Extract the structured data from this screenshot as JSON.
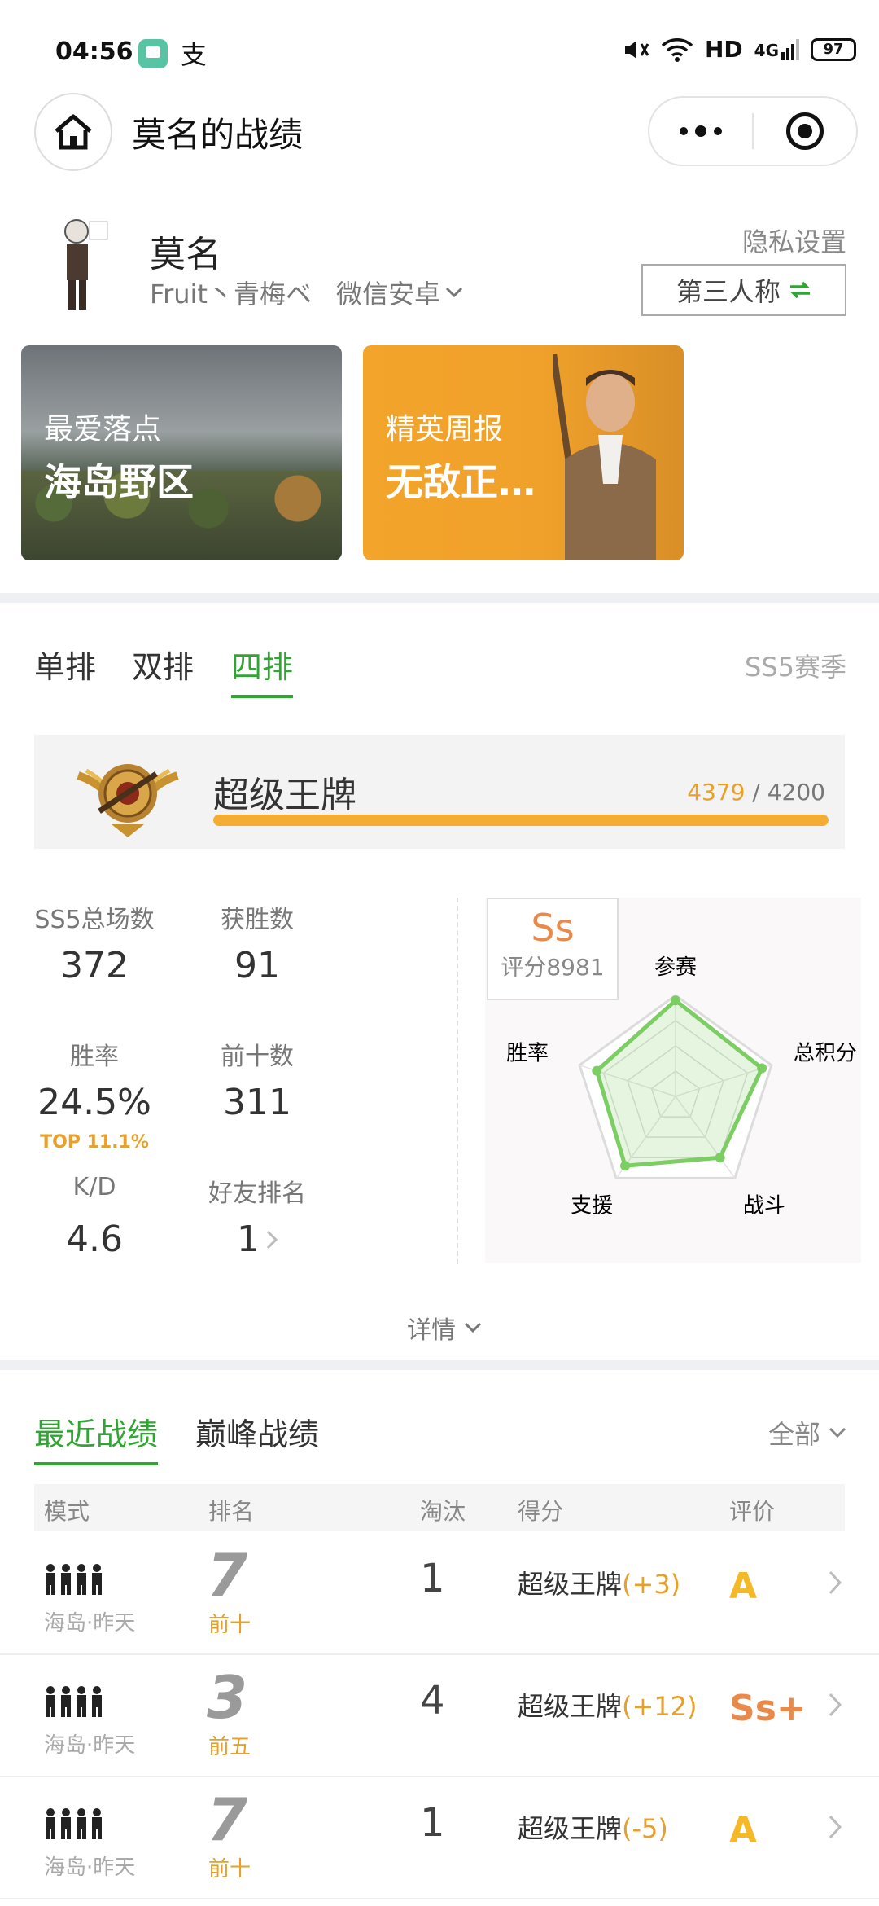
{
  "status": {
    "time": "04:56",
    "app2": "支",
    "network": "HD",
    "signal": "4G",
    "battery": "97"
  },
  "nav": {
    "title": "莫名的战绩"
  },
  "profile": {
    "name": "莫名",
    "nickname": "Fruit丶青梅ベ",
    "platform": "微信安卓",
    "privacy_label": "隐私设置",
    "perspective_label": "第三人称"
  },
  "banners": [
    {
      "label": "最爱落点",
      "value": "海岛野区"
    },
    {
      "label": "精英周报",
      "value": "无敌正…"
    }
  ],
  "mode_tabs": [
    "单排",
    "双排",
    "四排"
  ],
  "active_mode": "四排",
  "season": "SS5赛季",
  "rank": {
    "name": "超级王牌",
    "points": "4379",
    "threshold": "4200",
    "progress": 1.0
  },
  "stats": {
    "total_label": "SS5总场数",
    "total": "372",
    "wins_label": "获胜数",
    "wins": "91",
    "winrate_label": "胜率",
    "winrate": "24.5%",
    "winrate_top": "TOP 11.1%",
    "top10_label": "前十数",
    "top10": "311",
    "kd_label": "K/D",
    "kd": "4.6",
    "friend_rank_label": "好友排名",
    "friend_rank": "1"
  },
  "rating": {
    "grade": "Ss",
    "score": "评分8981"
  },
  "radar": {
    "axes": [
      "参赛",
      "总积分",
      "战斗",
      "支援",
      "胜率"
    ],
    "values": [
      0.95,
      0.9,
      0.75,
      0.85,
      0.82
    ],
    "color": "#7ccd63"
  },
  "details_label": "详情",
  "history_tabs": [
    "最近战绩",
    "巅峰战绩"
  ],
  "active_history": "最近战绩",
  "filter_label": "全部",
  "table_headers": [
    "模式",
    "排名",
    "淘汰",
    "得分",
    "评价"
  ],
  "matches": [
    {
      "mode": "海岛·昨天",
      "rank": "7",
      "rank_tag": "前十",
      "kills": "1",
      "tier": "超级王牌",
      "delta": "(+3)",
      "grade": "A",
      "grade_color": "#f5b827"
    },
    {
      "mode": "海岛·昨天",
      "rank": "3",
      "rank_tag": "前五",
      "kills": "4",
      "tier": "超级王牌",
      "delta": "(+12)",
      "grade": "Ss+",
      "grade_color": "#ea8a4a"
    },
    {
      "mode": "海岛·昨天",
      "rank": "7",
      "rank_tag": "前十",
      "kills": "1",
      "tier": "超级王牌",
      "delta": "(-5)",
      "grade": "A",
      "grade_color": "#f5b827"
    }
  ]
}
